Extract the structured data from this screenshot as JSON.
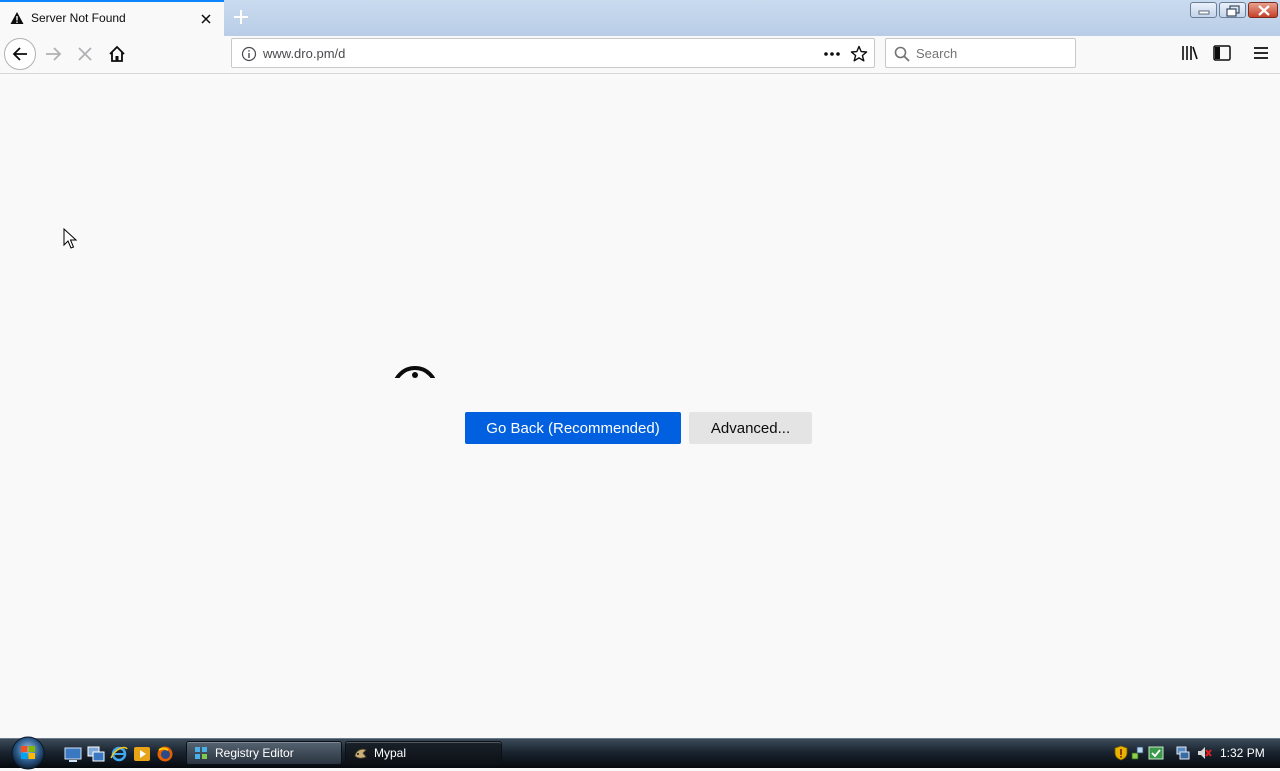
{
  "tab": {
    "title": "Server Not Found",
    "icon": "warning-icon"
  },
  "urlbar": {
    "url": "www.dro.pm/d"
  },
  "search": {
    "placeholder": "Search"
  },
  "content": {
    "go_back_label": "Go Back (Recommended)",
    "advanced_label": "Advanced..."
  },
  "taskbar": {
    "tasks": [
      {
        "label": "Registry Editor",
        "icon": "registry-editor-icon"
      },
      {
        "label": "Mypal",
        "icon": "mypal-icon"
      }
    ],
    "clock": "1:32 PM"
  },
  "colors": {
    "primary_button": "#0060df",
    "tab_highlight": "#0a84ff",
    "page_background": "#f9f9fa"
  }
}
